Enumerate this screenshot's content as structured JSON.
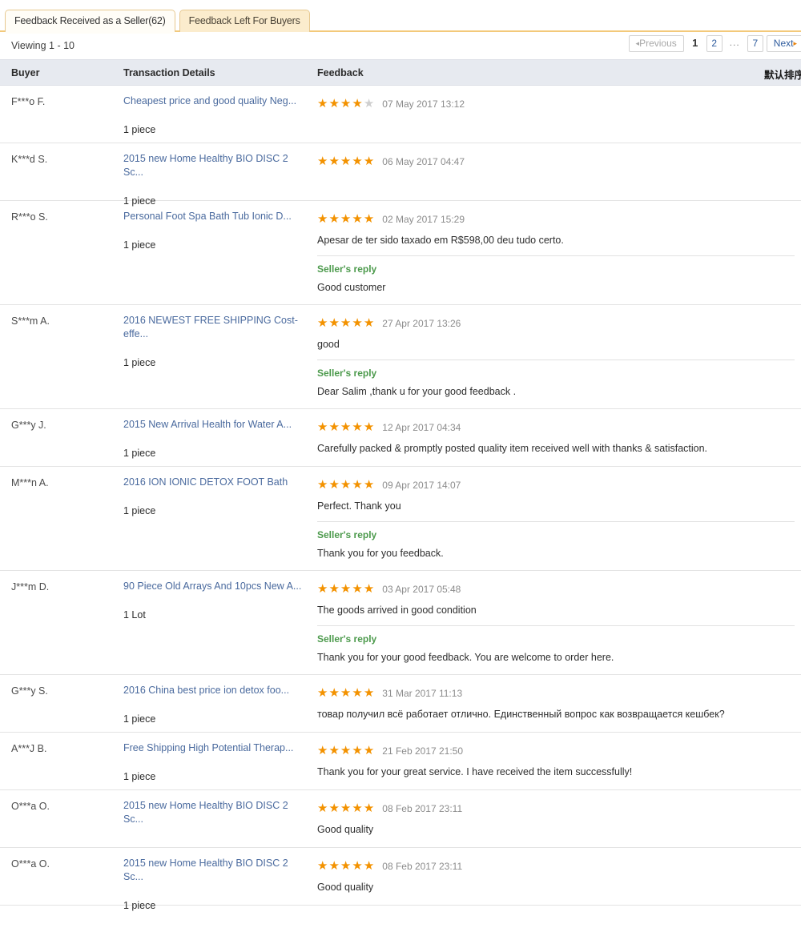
{
  "tabs": [
    {
      "label": "Feedback Received as a Seller(62)",
      "active": true
    },
    {
      "label": "Feedback Left For Buyers",
      "active": false
    }
  ],
  "viewing": "Viewing 1 - 10",
  "pagination": {
    "previous": "Previous",
    "next": "Next",
    "ellipsis": "...",
    "pages": [
      "1",
      "2",
      "7"
    ],
    "current": "1",
    "prev_arrow": "◂",
    "next_arrow": "▸"
  },
  "columns": {
    "buyer": "Buyer",
    "transaction": "Transaction Details",
    "feedback": "Feedback",
    "sort": "默认排序"
  },
  "star_glyph": "★",
  "reply_label": "Seller's reply",
  "rows": [
    {
      "buyer": "F***o F.",
      "title": "Cheapest price and good quality Neg...",
      "qty": "1 piece",
      "stars": 4,
      "date": "07 May 2017 13:12",
      "comment": "",
      "reply": ""
    },
    {
      "buyer": "K***d S.",
      "title": "2015 new Home Healthy BIO DISC 2 Sc...",
      "qty": "1 piece",
      "stars": 5,
      "date": "06 May 2017 04:47",
      "comment": "",
      "reply": ""
    },
    {
      "buyer": "R***o S.",
      "title": "Personal Foot Spa Bath Tub Ionic D...",
      "qty": "1 piece",
      "stars": 5,
      "date": "02 May 2017 15:29",
      "comment": "Apesar de ter sido taxado em R$598,00 deu tudo certo.",
      "reply": "Good customer"
    },
    {
      "buyer": "S***m A.",
      "title": "2016 NEWEST FREE SHIPPING Cost-effe...",
      "qty": "1 piece",
      "stars": 5,
      "date": "27 Apr 2017 13:26",
      "comment": "good",
      "reply": "Dear Salim ,thank u for your good feedback ."
    },
    {
      "buyer": "G***y J.",
      "title": "2015 New Arrival Health for Water A...",
      "qty": "1 piece",
      "stars": 5,
      "date": "12 Apr 2017 04:34",
      "comment": "Carefully packed & promptly posted quality item received well with thanks & satisfaction.",
      "reply": ""
    },
    {
      "buyer": "M***n A.",
      "title": "2016 ION IONIC DETOX FOOT Bath",
      "qty": "1 piece",
      "stars": 5,
      "date": "09 Apr 2017 14:07",
      "comment": "Perfect. Thank you",
      "reply": "Thank you for you feedback."
    },
    {
      "buyer": "J***m D.",
      "title": "90 Piece Old Arrays And 10pcs New A...",
      "qty": "1 Lot",
      "stars": 5,
      "date": "03 Apr 2017 05:48",
      "comment": "The goods arrived in good condition",
      "reply": "Thank you for your good feedback. You are welcome to order here."
    },
    {
      "buyer": "G***y S.",
      "title": "2016 China best price ion detox foo...",
      "qty": "1 piece",
      "stars": 5,
      "date": "31 Mar 2017 11:13",
      "comment": "товар получил всё работает отлично. Единственный вопрос как возвращается кешбек?",
      "reply": ""
    },
    {
      "buyer": "A***J B.",
      "title": "Free Shipping High Potential Therap...",
      "qty": "1 piece",
      "stars": 5,
      "date": "21 Feb 2017 21:50",
      "comment": "Thank you for your great service. I have received the item successfully!",
      "reply": ""
    },
    {
      "buyer": "O***a O.",
      "title": "2015 new Home Healthy BIO DISC 2 Sc...",
      "qty": "",
      "stars": 5,
      "date": "08 Feb 2017 23:11",
      "comment": "Good quality",
      "reply": ""
    },
    {
      "buyer": "O***a O.",
      "title": "2015 new Home Healthy BIO DISC 2 Sc...",
      "qty": "1 piece",
      "stars": 5,
      "date": "08 Feb 2017 23:11",
      "comment": "Good quality",
      "reply": ""
    }
  ],
  "colors": {
    "star_on": "#f39200",
    "star_off": "#cfcfcf",
    "link": "#4a6a9e",
    "reply_green": "#4c9a4c",
    "header_bg": "#e7eaf0",
    "tab_active_bg": "#fffdf7",
    "tab_inactive_bg": "#fbeccd"
  }
}
